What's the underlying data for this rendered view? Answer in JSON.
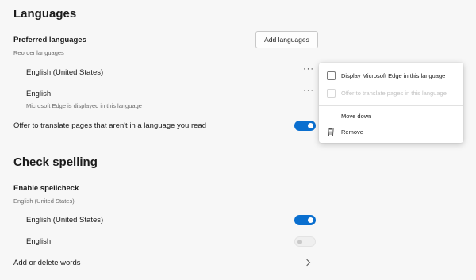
{
  "languages": {
    "heading": "Languages",
    "preferred": {
      "title": "Preferred languages",
      "subtitle": "Reorder languages",
      "add_button": "Add languages"
    },
    "items": [
      {
        "label": "English (United States)",
        "sublabel": "",
        "more": "···"
      },
      {
        "label": "English",
        "sublabel": "Microsoft Edge is displayed in this language",
        "more": "···"
      }
    ],
    "offer_translate": {
      "label": "Offer to translate pages that aren't in a language you read",
      "enabled": true
    }
  },
  "context_menu": {
    "items": [
      {
        "label": "Display Microsoft Edge in this language",
        "type": "checkbox",
        "checked": false,
        "disabled": false
      },
      {
        "label": "Offer to translate pages in this language",
        "type": "checkbox",
        "checked": false,
        "disabled": true
      },
      {
        "label": "Move down",
        "type": "action",
        "icon": ""
      },
      {
        "label": "Remove",
        "type": "action",
        "icon": "trash-icon"
      }
    ]
  },
  "spelling": {
    "heading": "Check spelling",
    "enable": {
      "title": "Enable spellcheck",
      "subtitle": "English (United States)"
    },
    "languages": [
      {
        "label": "English (United States)",
        "enabled": true
      },
      {
        "label": "English",
        "enabled": false
      }
    ],
    "words_link": {
      "label": "Add or delete words",
      "icon": "chevron-right-icon"
    }
  },
  "colors": {
    "accent": "#0a6fcf",
    "background": "#f7f7f7"
  }
}
